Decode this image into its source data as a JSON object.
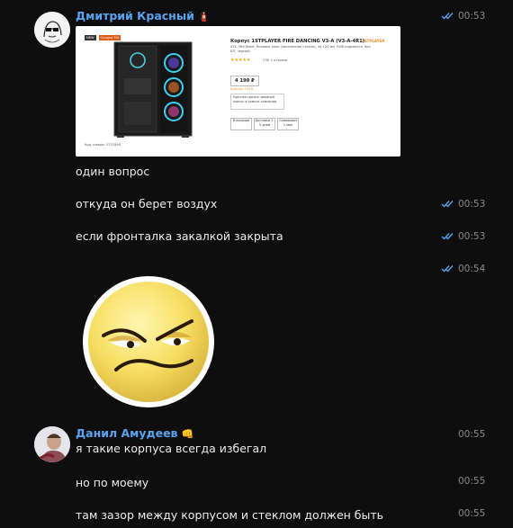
{
  "messages": [
    {
      "sender": "Дмитрий Красный",
      "sender_emoji": "🧯",
      "time": "00:53",
      "read": true,
      "preview": {
        "badges": [
          "NEW",
          "Скидка 5%"
        ],
        "product_title": "Корпус 1STPLAYER FIRE DANCING V3-A (V3-A-4R1)",
        "product_desc": "ATX, Mid-Tower, боковое окно (закаленное стекло), 4x 120 мм, RGB подсветка, без БП, черный",
        "brand": "1STPLAYER",
        "rating": "★★★★★",
        "reviews": "(96)  2 отзывов",
        "price": "4 190 ₽",
        "bonus": "Бонусы +419",
        "note": "Удачная сделка: двойной корпус в рамках кампании",
        "boxes": [
          "В наличии",
          "Доставка 2-5 дней",
          "Самовывоз 1 мин"
        ],
        "code": "Код товара: 1771858"
      }
    },
    {
      "text": "один вопрос"
    },
    {
      "text": "откуда он берет воздух",
      "time": "00:53",
      "read": true
    },
    {
      "text": "если фронталка закалкой закрыта",
      "time": "00:53",
      "read": true
    },
    {
      "sticker": "angry-smiley",
      "time": "00:54",
      "read": true
    },
    {
      "sender": "Данил Амудеев",
      "sender_emoji": "👊",
      "text": "я такие корпуса всегда избегал",
      "time": "00:55"
    },
    {
      "text": "но по моему",
      "time": "00:55"
    },
    {
      "text": "там зазор между корпусом и стеклом должен быть",
      "time": "00:55"
    }
  ],
  "colors": {
    "background": "#0e0e0e",
    "sender_name": "#5aa3ef",
    "read_check": "#5aa3ef",
    "timestamp": "#8a8a8a",
    "text": "#ececec"
  }
}
